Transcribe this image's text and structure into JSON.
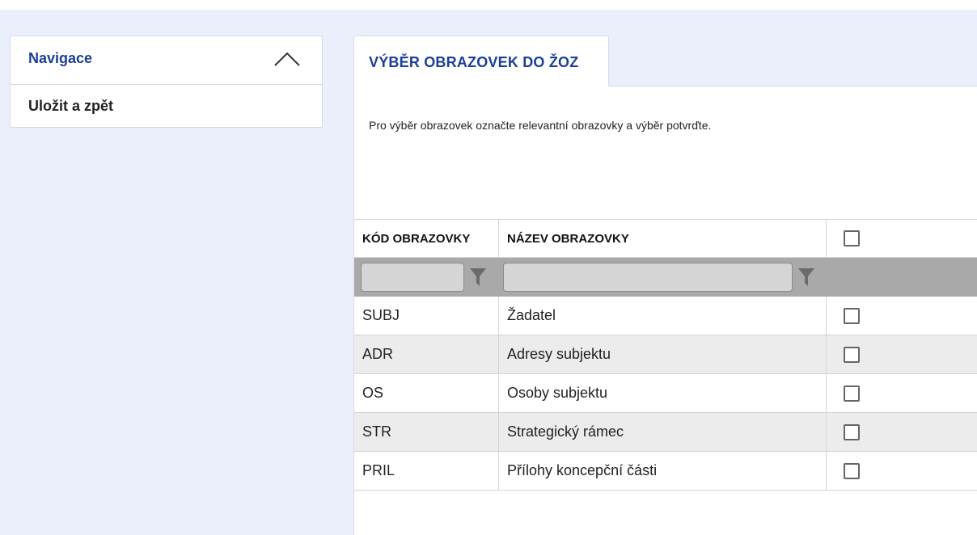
{
  "sidebar": {
    "title": "Navigace",
    "items": [
      {
        "label": "Uložit a zpět"
      }
    ]
  },
  "tab": {
    "label": "VÝBĚR OBRAZOVEK DO ŽOZ"
  },
  "instruction": "Pro výběr obrazovek označte relevantní obrazovky a výběr potvrďte.",
  "table": {
    "columns": [
      "KÓD OBRAZOVKY",
      "NÁZEV OBRAZOVKY"
    ],
    "rows": [
      {
        "code": "SUBJ",
        "name": "Žadatel",
        "checked": false
      },
      {
        "code": "ADR",
        "name": "Adresy subjektu",
        "checked": false
      },
      {
        "code": "OS",
        "name": "Osoby subjektu",
        "checked": false
      },
      {
        "code": "STR",
        "name": "Strategický rámec",
        "checked": false
      },
      {
        "code": "PRIL",
        "name": "Přílohy koncepční části",
        "checked": false
      }
    ]
  },
  "colors": {
    "accent": "#1b3f94",
    "page_background": "#ebeffb",
    "filter_bar": "#a9a9a9",
    "row_alt": "#ececec"
  },
  "icons": {
    "collapse": "chevron-up-icon",
    "filter": "funnel-icon"
  }
}
